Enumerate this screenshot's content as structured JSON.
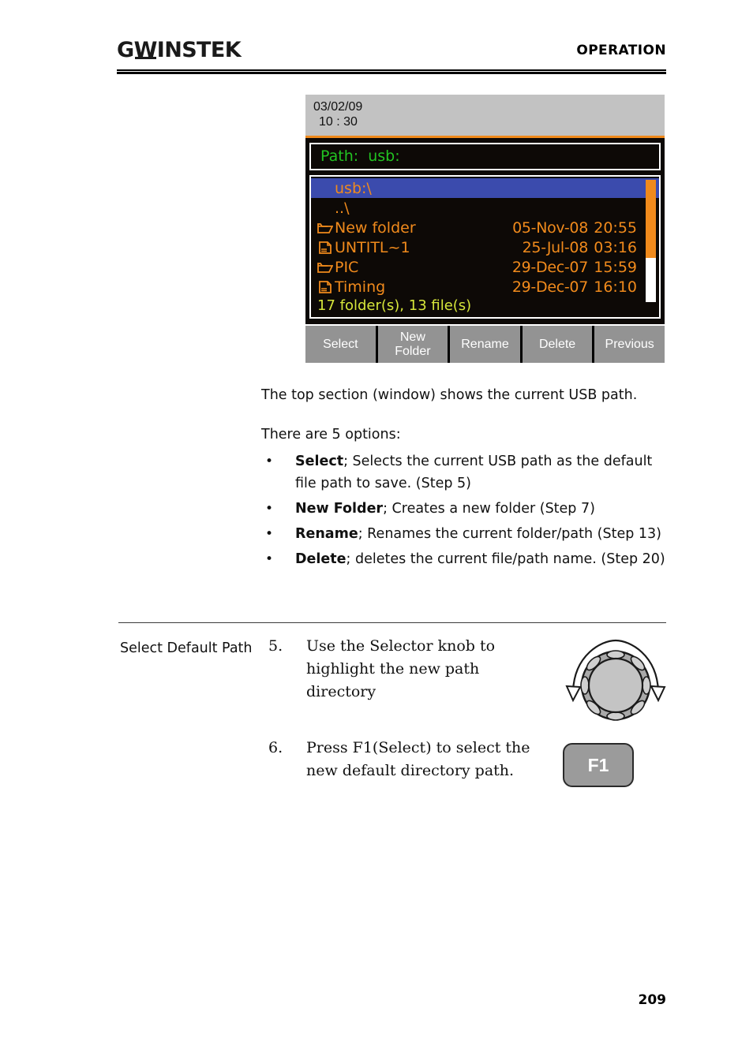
{
  "header": {
    "brand_prefix": "G",
    "brand_w": "W",
    "brand_suffix": "INSTEK",
    "section_title": "OPERATION"
  },
  "device_screen": {
    "status": {
      "date": "03/02/09",
      "time": "10 : 30"
    },
    "path_bar": {
      "text": "Path:  usb:"
    },
    "file_list": [
      {
        "icon": "none",
        "name": "usb:\\",
        "date": "",
        "time": "",
        "selected": true
      },
      {
        "icon": "none",
        "name": "..\\",
        "date": "",
        "time": "",
        "selected": false
      },
      {
        "icon": "folder",
        "name": "New folder",
        "date": "05-Nov-08",
        "time": "20:55",
        "selected": false
      },
      {
        "icon": "file",
        "name": "UNTITL~1",
        "date": "25-Jul-08",
        "time": "03:16",
        "selected": false
      },
      {
        "icon": "folder",
        "name": "PIC",
        "date": "29-Dec-07",
        "time": "15:59",
        "selected": false
      },
      {
        "icon": "file",
        "name": "Timing",
        "date": "29-Dec-07",
        "time": "16:10",
        "selected": false
      }
    ],
    "summary": "17 folder(s), 13 file(s)",
    "scrollbar": {
      "thumb_percent": 64
    },
    "softkeys": [
      {
        "line1": "Select",
        "line2": ""
      },
      {
        "line1": "New",
        "line2": "Folder"
      },
      {
        "line1": "Rename",
        "line2": ""
      },
      {
        "line1": "Delete",
        "line2": ""
      },
      {
        "line1": "Previous",
        "line2": ""
      }
    ],
    "colors": {
      "status_bg": "#c2c2c2",
      "screen_bg": "#0d0906",
      "path_text": "#22c322",
      "file_text": "#f08a1c",
      "selected_bg": "#3b4bad",
      "summary_text": "#d6e63a",
      "softkey_bg": "#939393"
    }
  },
  "prose": {
    "para1": "The top section (window) shows the current USB path.",
    "para2": "There are 5 options:",
    "bullets": [
      {
        "term": "Select",
        "rest": "; Selects the current USB path as the default file path to save. (Step 5)"
      },
      {
        "term": "New Folder",
        "rest": "; Creates a new folder (Step 7)"
      },
      {
        "term": "Rename",
        "rest": "; Renames the current folder/path (Step 13)"
      },
      {
        "term": "Delete",
        "rest": "; deletes the current file/path name. (Step 20)"
      }
    ]
  },
  "steps_section": {
    "side_label": "Select Default Path",
    "steps": [
      {
        "number": "5.",
        "text": "Use the Selector knob to highlight the new path directory"
      },
      {
        "number": "6.",
        "text": "Press F1(Select) to select the new default directory path."
      }
    ],
    "f1_key_label": "F1"
  },
  "footer": {
    "page_number": "209"
  }
}
